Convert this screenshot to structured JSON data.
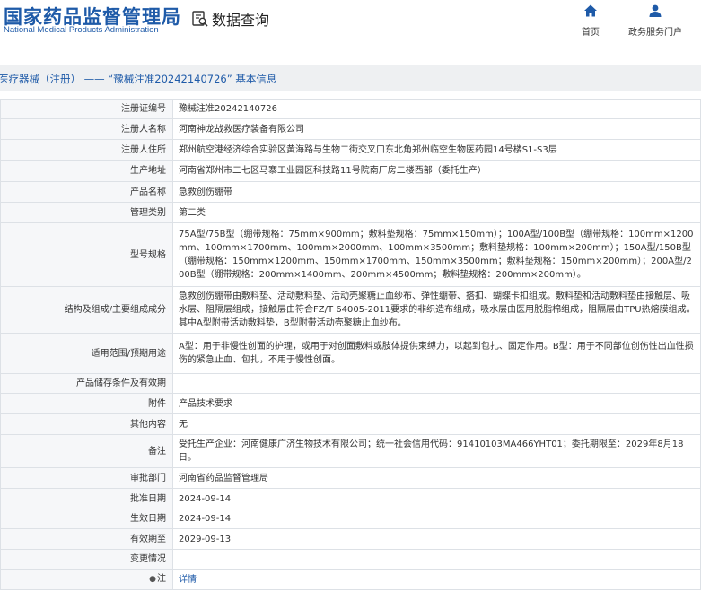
{
  "header": {
    "logo_cn": "国家药品监督管理局",
    "logo_en": "National Medical Products Administration",
    "section_icon": "search-doc-icon",
    "section_label": "数据查询",
    "nav": [
      {
        "label": "首页",
        "icon": "home-icon"
      },
      {
        "label": "政务服务门户",
        "icon": "user-icon"
      }
    ]
  },
  "titlebar": {
    "text": "医疗器械（注册） —— “豫械注准20242140726” 基本信息"
  },
  "details": {
    "rows": [
      {
        "label": "注册证编号",
        "value": "豫械注准20242140726"
      },
      {
        "label": "注册人名称",
        "value": "河南神龙战救医疗装备有限公司"
      },
      {
        "label": "注册人住所",
        "value": "郑州航空港经济综合实验区黄海路与生物二街交叉口东北角郑州临空生物医药园14号楼S1-S3层"
      },
      {
        "label": "生产地址",
        "value": "河南省郑州市二七区马寨工业园区科技路11号院南厂房二楼西部（委托生产）"
      },
      {
        "label": "产品名称",
        "value": "急救创伤绷带"
      },
      {
        "label": "管理类别",
        "value": "第二类"
      },
      {
        "label": "型号规格",
        "value": "75A型/75B型（绷带规格：75mm×900mm；敷料垫规格：75mm×150mm）；100A型/100B型（绷带规格：100mm×1200mm、100mm×1700mm、100mm×2000mm、100mm×3500mm；敷料垫规格：100mm×200mm）；150A型/150B型（绷带规格：150mm×1200mm、150mm×1700mm、150mm×3500mm；敷料垫规格：150mm×200mm）；200A型/200B型（绷带规格：200mm×1400mm、200mm×4500mm；敷料垫规格：200mm×200mm）。"
      },
      {
        "label": "结构及组成/主要组成成分",
        "value": "急救创伤绷带由敷料垫、活动敷料垫、活动壳聚糖止血纱布、弹性绷带、搭扣、蝴蝶卡扣组成。敷料垫和活动敷料垫由接触层、吸水层、阻隔层组成，接触层由符合FZ/T 64005-2011要求的非织造布组成，吸水层由医用脱脂棉组成，阻隔层由TPU热熔膜组成。其中A型附带活动敷料垫，B型附带活动壳聚糖止血纱布。"
      },
      {
        "label": "适用范围/预期用途",
        "value": "A型：用于非慢性创面的护理，或用于对创面敷料或肢体提供束缚力，以起到包扎、固定作用。B型：用于不同部位创伤性出血性损伤的紧急止血、包扎，不用于慢性创面。"
      },
      {
        "label": "产品储存条件及有效期",
        "value": ""
      },
      {
        "label": "附件",
        "value": "产品技术要求"
      },
      {
        "label": "其他内容",
        "value": "无"
      },
      {
        "label": "备注",
        "value": "受托生产企业：河南健康广济生物技术有限公司；统一社会信用代码：91410103MA466YHT01；委托期限至：2029年8月18日。"
      },
      {
        "label": "审批部门",
        "value": "河南省药品监督管理局"
      },
      {
        "label": "批准日期",
        "value": "2024-09-14"
      },
      {
        "label": "生效日期",
        "value": "2024-09-14"
      },
      {
        "label": "有效期至",
        "value": "2029-09-13"
      },
      {
        "label": "变更情况",
        "value": ""
      }
    ],
    "note_row": {
      "icon": "pin-icon",
      "label": "注",
      "link_text": "详情"
    }
  }
}
